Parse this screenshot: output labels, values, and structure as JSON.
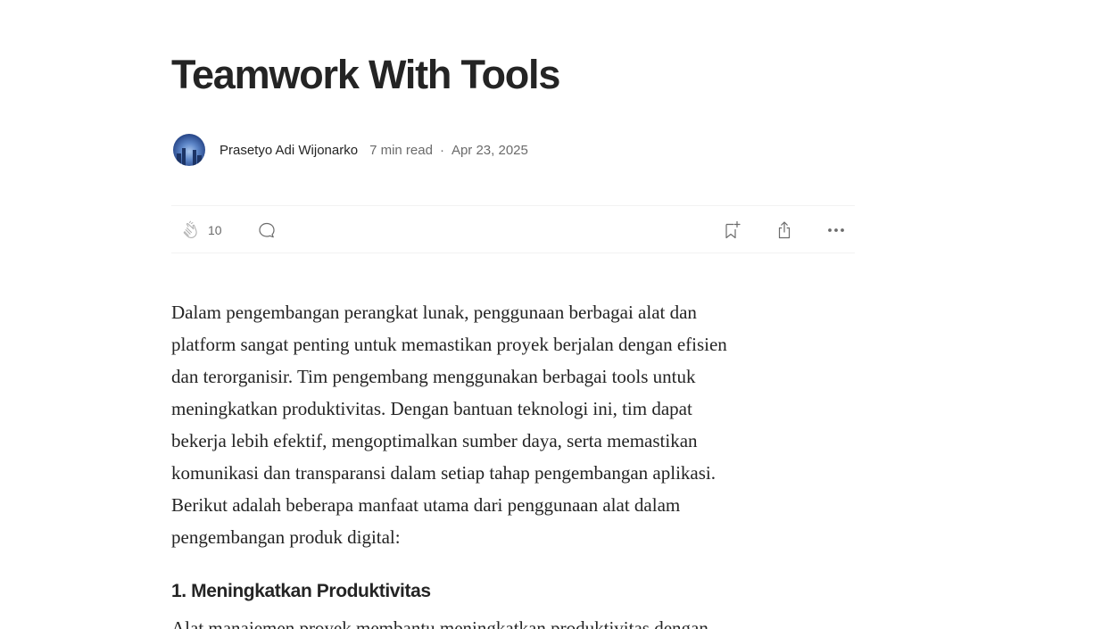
{
  "article": {
    "title": "Teamwork With Tools",
    "author": "Prasetyo Adi Wijonarko",
    "read_time": "7 min read",
    "separator": "·",
    "date": "Apr 23, 2025"
  },
  "actions": {
    "clap_count": "10",
    "clap_icon": "clap-icon",
    "respond_icon": "comment-icon",
    "save_icon": "bookmark-add-icon",
    "share_icon": "share-icon",
    "more_icon": "more-horizontal-icon"
  },
  "content": {
    "intro_lines": [
      "Dalam pengembangan perangkat lunak, penggunaan berbagai alat dan",
      "platform sangat penting untuk memastikan proyek berjalan dengan efisien",
      "dan terorganisir. Tim pengembang menggunakan berbagai tools untuk",
      "meningkatkan produktivitas. Dengan bantuan teknologi ini, tim dapat",
      "bekerja lebih efektif, mengoptimalkan sumber daya, serta memastikan",
      "komunikasi dan transparansi dalam setiap tahap pengembangan aplikasi.",
      "Berikut adalah beberapa manfaat utama dari penggunaan alat dalam",
      "pengembangan produk digital:"
    ],
    "section_1_heading": "1. Meningkatkan Produktivitas",
    "section_1_first_line": "Alat manajemen proyek membantu meningkatkan produktivitas dengan"
  },
  "colors": {
    "text": "#242424",
    "muted": "#6b6b6b",
    "divider": "#f2f2f2"
  }
}
